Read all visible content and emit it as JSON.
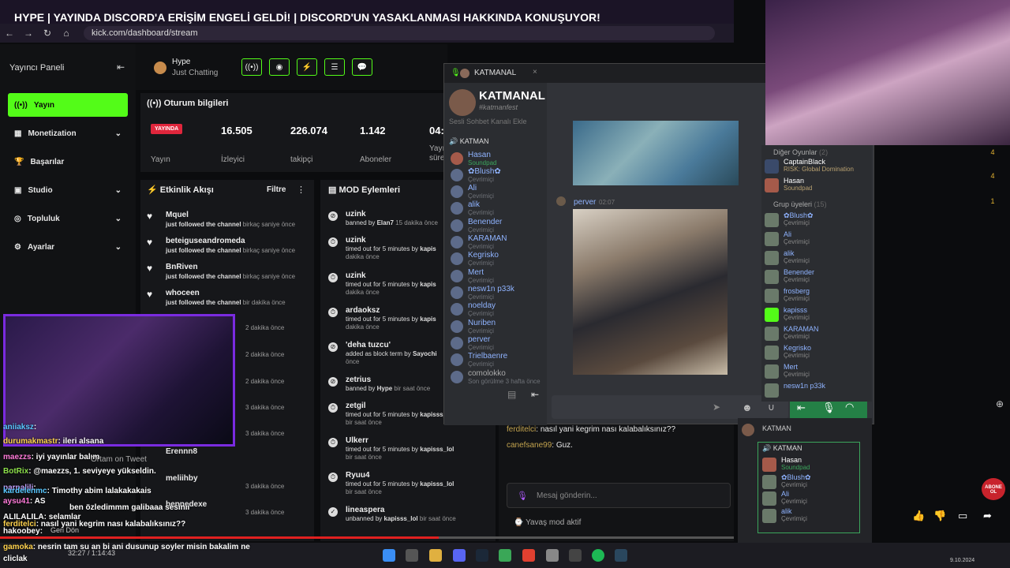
{
  "stream_title": "HYPE | YAYINDA DISCORD'A ERİŞİM ENGELİ GELDİ! | DISCORD'UN YASAKLANMASI HAKKINDA KONUŞUYOR!",
  "browser": {
    "url": "kick.com/dashboard/stream"
  },
  "sidebar": {
    "title": "Yayıncı Paneli",
    "items": [
      {
        "label": "Yayın",
        "icon": "broadcast-icon"
      },
      {
        "label": "Monetization",
        "icon": "grid-icon"
      },
      {
        "label": "Başarılar",
        "icon": "trophy-icon"
      },
      {
        "label": "Studio",
        "icon": "studio-icon"
      },
      {
        "label": "Topluluk",
        "icon": "community-icon"
      },
      {
        "label": "Ayarlar",
        "icon": "settings-icon"
      }
    ]
  },
  "header": {
    "category_name": "Hype",
    "category_sub": "Just Chatting"
  },
  "session": {
    "title": "Oturum bilgileri",
    "live_badge": "YAYINDA",
    "stats": [
      {
        "value": "16.505",
        "label": "İzleyici"
      },
      {
        "value": "226.074",
        "label": "takipçi"
      },
      {
        "value": "1.142",
        "label": "Aboneler"
      },
      {
        "value": "04:",
        "label": "Yayı süre"
      }
    ],
    "yayin_label": "Yayın"
  },
  "activity": {
    "title": "Etkinlik Akışı",
    "filter": "Filtre",
    "rows": [
      {
        "name": "Mquel",
        "text": "just followed the channel",
        "time": "birkaç saniye önce"
      },
      {
        "name": "beteiguseandromeda",
        "text": "just followed the channel",
        "time": "birkaç saniye önce"
      },
      {
        "name": "BnRiven",
        "text": "just followed the channel",
        "time": "birkaç saniye önce"
      },
      {
        "name": "whoceen",
        "text": "just followed the channel",
        "time": "bir dakika önce"
      }
    ],
    "extra_times": [
      "2 dakika önce",
      "2 dakika önce",
      "2 dakika önce",
      "3 dakika önce",
      "3 dakika önce",
      "3 dakika önce",
      "3 dakika önce"
    ],
    "extra_names": [
      "Erennn8",
      "meliihby",
      "bennedexe"
    ]
  },
  "mod": {
    "title": "MOD Eylemleri",
    "rows": [
      {
        "name": "uzink",
        "text": "banned by ",
        "by": "Elan7",
        "time": "15 dakika önce"
      },
      {
        "name": "uzink",
        "text": "timed out for 5 minutes by ",
        "by": "kapis",
        "time": "dakika önce"
      },
      {
        "name": "uzink",
        "text": "timed out for 5 minutes by ",
        "by": "kapis",
        "time": "dakika önce"
      },
      {
        "name": "ardaoksz",
        "text": "timed out for 5 minutes by ",
        "by": "kapis",
        "time": "dakika önce"
      },
      {
        "name": "'deha tuzcu'",
        "text": "added as block term by ",
        "by": "Sayochi",
        "time": "önce"
      },
      {
        "name": "zetrius",
        "text": "banned by ",
        "by": "Hype",
        "time": "bir saat önce"
      },
      {
        "name": "zetgil",
        "text": "timed out for 5 minutes by ",
        "by": "kapisss_lol",
        "time": "bir saat önce"
      },
      {
        "name": "Ulkerr",
        "text": "timed out for 5 minutes by ",
        "by": "kapisss_lol",
        "time": "bir saat önce"
      },
      {
        "name": "Ryuu4",
        "text": "timed out for 5 minutes by ",
        "by": "kapisss_lol",
        "time": "bir saat önce"
      },
      {
        "name": "lineaspera",
        "text": "unbanned by ",
        "by": "kapisss_lol",
        "time": "bir saat önce"
      }
    ]
  },
  "discord": {
    "tab": "KATMANAL",
    "server_name": "KATMANAL",
    "server_tag": "#katmanfest",
    "add_channel": "Sesli Sohbet Kanalı Ekle",
    "voice_channel": "KATMAN",
    "members": [
      {
        "name": "Hasan",
        "status": "Soundpad"
      },
      {
        "name": "✿Blush✿",
        "status": "Çevrimiçi"
      },
      {
        "name": "Ali",
        "status": "Çevrimiçi"
      },
      {
        "name": "alik",
        "status": "Çevrimiçi"
      },
      {
        "name": "Benender",
        "status": "Çevrimiçi"
      },
      {
        "name": "KARAMAN",
        "status": "Çevrimiçi"
      },
      {
        "name": "Kegrisko",
        "status": "Çevrimiçi"
      },
      {
        "name": "Mert",
        "status": "Çevrimiçi"
      },
      {
        "name": "nesw1n p33k",
        "status": "Çevrimiçi"
      },
      {
        "name": "noelday",
        "status": "Çevrimiçi"
      },
      {
        "name": "Nuriben",
        "status": "Çevrimiçi"
      },
      {
        "name": "perver",
        "status": "Çevrimiçi"
      },
      {
        "name": "Trielbaenre",
        "status": "Çevrimiçi"
      },
      {
        "name": "comolokko",
        "status": "Son görülme 3 hafta önce"
      }
    ],
    "post_author": "perver",
    "post_time": "02:07",
    "kick_chat": [
      {
        "user": "ferditelci",
        "text": "nasıl yani kegrim nası kalabalıksınız??"
      },
      {
        "user": "canefsane99",
        "text": "Guz."
      }
    ],
    "send_placeholder": "Mesaj gönderin...",
    "slow_mode": "Yavaş mod aktif"
  },
  "right_panel": {
    "other_games_title": "Diğer Oyunlar",
    "other_games_count": "2",
    "other": [
      {
        "name": "CaptainBlack",
        "status": "RISK: Global Domination"
      },
      {
        "name": "Hasan",
        "status": "Soundpad"
      }
    ],
    "group_title": "Grup üyeleri",
    "group_count": "15",
    "group": [
      {
        "name": "✿Blush✿",
        "status": "Çevrimiçi"
      },
      {
        "name": "Ali",
        "status": "Çevrimiçi"
      },
      {
        "name": "alik",
        "status": "Çevrimiçi"
      },
      {
        "name": "Benender",
        "status": "Çevrimiçi"
      },
      {
        "name": "frosberg",
        "status": "Çevrimiçi"
      },
      {
        "name": "kapisss",
        "status": "Çevrimiçi"
      },
      {
        "name": "KARAMAN",
        "status": "Çevrimiçi"
      },
      {
        "name": "Kegrisko",
        "status": "Çevrimiçi"
      },
      {
        "name": "Mert",
        "status": "Çevrimiçi"
      },
      {
        "name": "nesw1n p33k",
        "status": ""
      }
    ],
    "mini_channel": "KATMAN",
    "mini_server": "KATMAN",
    "mini_members": [
      {
        "name": "Hasan",
        "status": "Soundpad"
      },
      {
        "name": "✿Blush✿",
        "status": "Çevrimiçi"
      },
      {
        "name": "Ali",
        "status": "Çevrimiçi"
      },
      {
        "name": "alik",
        "status": "Çevrimiçi"
      }
    ],
    "counts": [
      "4",
      "4",
      "1"
    ]
  },
  "overlay_chat": [
    {
      "user": "aniiaksz",
      "text": ":",
      "color": "#59c8ff"
    },
    {
      "user": "durumakmastr",
      "text": ": ileri alsana",
      "color": "#ffd34d"
    },
    {
      "user": "maezzs",
      "text": ": iyi yayınlar balım",
      "color": "#ff7ad9"
    },
    {
      "user": "BotRix",
      "text": ": @maezzs, 1. seviyeye yükseldin.",
      "color": "#8de04b"
    },
    {
      "user": "parpalili",
      "text": ":",
      "color": "#c6a3ff"
    },
    {
      "user": "kardelenmc",
      "text": ": Timothy abim lalakakakais",
      "color": "#59c8ff"
    },
    {
      "user": "aysu41",
      "text": ": AS",
      "color": "#ff7ad9"
    },
    {
      "user": "",
      "text": "ben özledimmm galibaaa sesinii",
      "color": "#ffffff"
    },
    {
      "user": "ALILALILA",
      "text": ": selamlar",
      "color": "#ffffff"
    },
    {
      "user": "ferditelci",
      "text": ": nasıl yani kegrim nası kalabalıksınız??",
      "color": "#ffd34d"
    },
    {
      "user": "hakoobey",
      "text": ":",
      "color": "#ffffff"
    },
    {
      "user": "gamoka",
      "text": ": nesrin tam su an bi ani dusunup soyler misin bakalim ne",
      "color": "#ffd34d"
    },
    {
      "user": "cliclak",
      "text": "",
      "color": "#ffffff"
    }
  ],
  "overlay_extras": {
    "tweet": "Ortam on Tweet",
    "back": "Geri Dön",
    "player_time": "32:27 / 1:14:43",
    "date": "9.10.2024",
    "abone": "ABONE OL"
  },
  "colors": {
    "accent": "#53fc18",
    "live": "#e0263c",
    "discord_bg": "#313338"
  }
}
